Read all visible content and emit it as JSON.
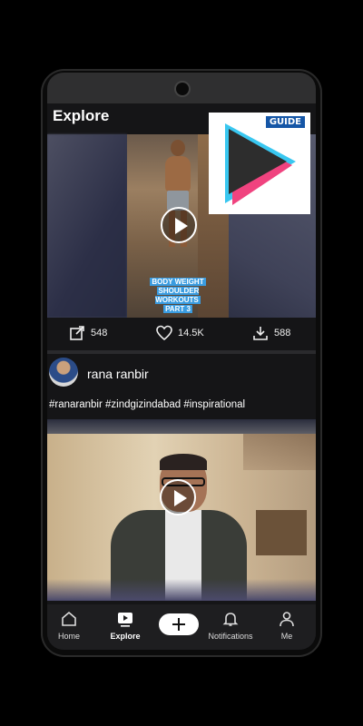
{
  "header": {
    "title": "Explore"
  },
  "post1": {
    "caption_lines": [
      "BODY WEIGHT",
      "SHOULDER WORKOUTS",
      "PART 3"
    ],
    "guide_tag": "GUIDE",
    "stats": {
      "shares": "548",
      "likes": "14.5K",
      "downloads": "588"
    }
  },
  "post2": {
    "author": "rana ranbir",
    "hashtags": "#ranaranbir #zindgizindabad #inspirational"
  },
  "nav": {
    "home": "Home",
    "explore": "Explore",
    "notifications": "Notifications",
    "me": "Me"
  },
  "colors": {
    "background": "#151517",
    "caption_highlight": "#3a9ce0",
    "guide_blue": "#1556a6",
    "logo_cyan": "#39c7f0",
    "logo_pink": "#f0437f"
  }
}
